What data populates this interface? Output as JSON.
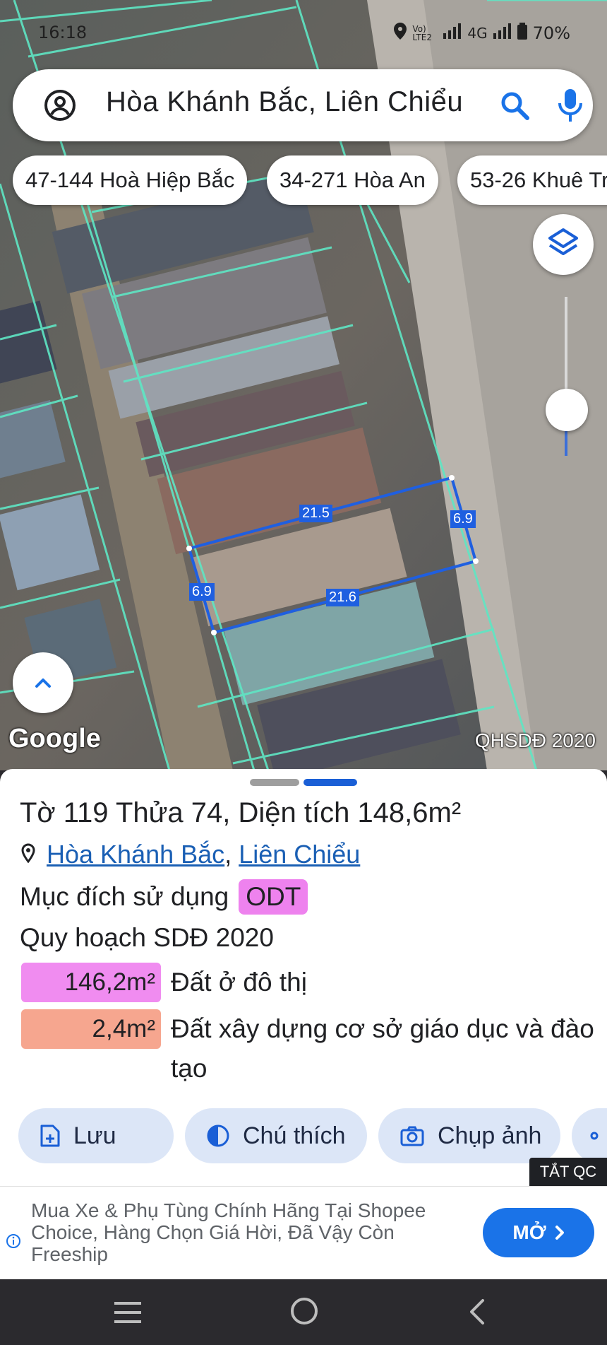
{
  "status_bar": {
    "time": "16:18",
    "network_1": "Vo) LTE2",
    "network_2": "4G",
    "battery": "70%"
  },
  "search": {
    "query": "Hòa Khánh Bắc, Liên Chiểu"
  },
  "chips": [
    "47-144 Hoà Hiệp Bắc",
    "34-271 Hòa An",
    "53-26 Khuê Tr"
  ],
  "map": {
    "logo": "Google",
    "attribution": "QHSDĐ 2020",
    "dimensions": {
      "top": "21.5",
      "right": "6.9",
      "bottom": "21.6",
      "left": "6.9"
    },
    "colors": {
      "parcel_outline": "#5fe6c4",
      "selection": "#1f5fe0"
    }
  },
  "sheet": {
    "title": "Tờ 119 Thửa 74, Diện tích 148,6m²",
    "location": {
      "ward": "Hòa Khánh Bắc",
      "separator": ",",
      "district": "Liên Chiểu"
    },
    "purpose_label": "Mục đích sử dụng",
    "purpose_code": "ODT",
    "plan_label": "Quy hoạch SDĐ 2020",
    "areas": [
      {
        "value": "146,2m²",
        "desc": "Đất ở đô thị",
        "color": "#f08cf0"
      },
      {
        "value": "2,4m²",
        "desc": "Đất xây dựng cơ sở giáo dục và đào tạo",
        "color": "#f6a68f"
      }
    ],
    "actions": {
      "save": "Lưu",
      "legend": "Chú thích",
      "capture": "Chụp ảnh"
    }
  },
  "ad": {
    "close_label": "TẮT QC",
    "text": "Mua Xe & Phụ Tùng Chính Hãng Tại Shopee Choice, Hàng Chọn Giá Hời, Đã Vậy Còn Freeship",
    "open_label": "MỞ"
  }
}
